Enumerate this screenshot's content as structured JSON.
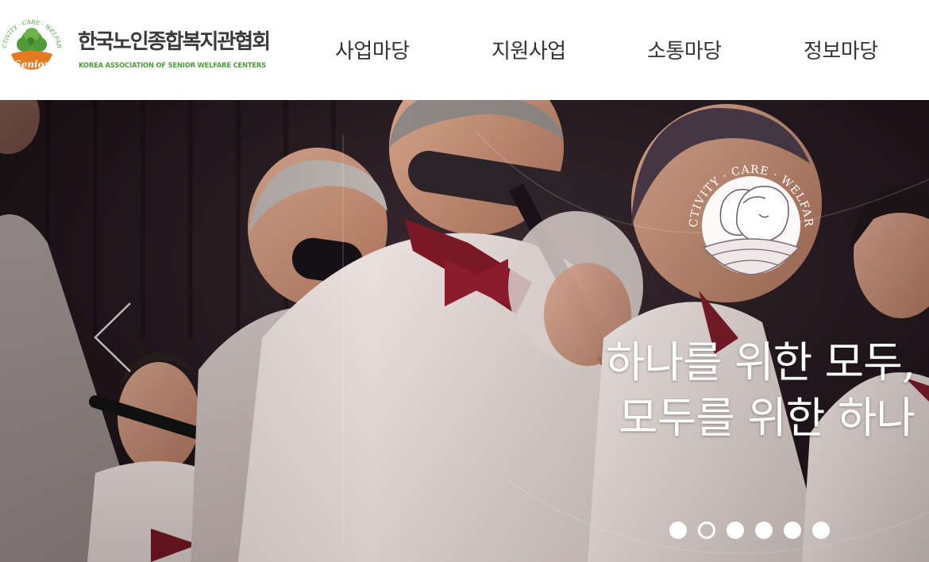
{
  "header": {
    "logo": {
      "title": "한국노인종합복지관협회",
      "subtitle": "KOREA ASSOCIATION OF SENIOR WELFARE CENTERS",
      "emblem_text": "Senior",
      "emblem_arc": "ACTIVITY · CARE · WELFARE",
      "emblem_icon": "senior-tree-emblem"
    },
    "nav": [
      {
        "label": "사업마당"
      },
      {
        "label": "지원사업"
      },
      {
        "label": "소통마당"
      },
      {
        "label": "정보마당"
      }
    ]
  },
  "hero": {
    "background_icon": "senior-choir-photo",
    "prev_icon": "chevron-left-icon",
    "emblem_arc": "ACTIVITY · CARE · WELFARE",
    "emblem_icon": "senior-faces-emblem",
    "headline_line1": "하나를 위한 모두,",
    "headline_line2": "모두를 위한 하나",
    "slides_total": 6,
    "active_slide": 2
  },
  "colors": {
    "accent_green": "#4f9a3b",
    "accent_orange": "#e27a22",
    "text_dark": "#333333"
  }
}
